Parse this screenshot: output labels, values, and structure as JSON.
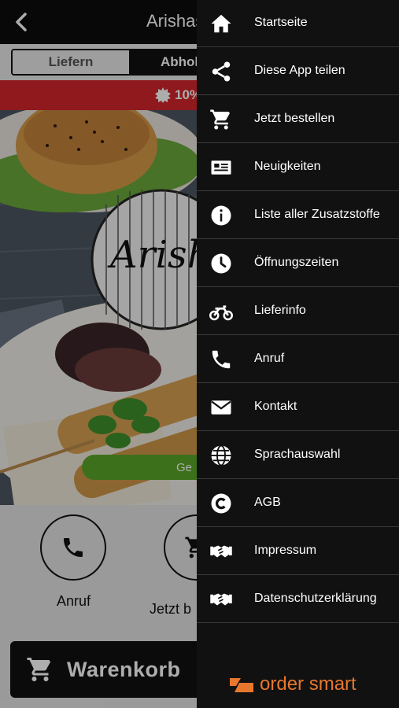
{
  "header": {
    "title": "Arishas",
    "back_icon": "chevron-left-icon"
  },
  "segment": {
    "deliver_label": "Liefern",
    "pickup_label": "Abholen",
    "selected": "Abholen"
  },
  "promo": {
    "text": "10%"
  },
  "hero": {
    "logo_text": "Arish",
    "order_button_label": "Ge"
  },
  "actions": [
    {
      "label": "Anruf",
      "icon": "phone-icon"
    },
    {
      "label": "Jetzt b",
      "icon": "cart-icon"
    }
  ],
  "cart": {
    "label": "Warenkorb",
    "icon": "cart-icon"
  },
  "menu": {
    "items": [
      {
        "label": "Startseite",
        "icon": "home-icon"
      },
      {
        "label": "Diese App teilen",
        "icon": "share-icon"
      },
      {
        "label": "Jetzt bestellen",
        "icon": "cart-icon"
      },
      {
        "label": "Neuigkeiten",
        "icon": "news-icon"
      },
      {
        "label": "Liste aller Zusatzstoffe",
        "icon": "info-icon"
      },
      {
        "label": "Öffnungszeiten",
        "icon": "clock-icon"
      },
      {
        "label": "Lieferinfo",
        "icon": "motorbike-icon"
      },
      {
        "label": "Anruf",
        "icon": "phone-icon"
      },
      {
        "label": "Kontakt",
        "icon": "envelope-icon"
      },
      {
        "label": "Sprachauswahl",
        "icon": "globe-icon"
      },
      {
        "label": "AGB",
        "icon": "copyright-icon"
      },
      {
        "label": "Impressum",
        "icon": "handshake-icon"
      },
      {
        "label": "Datenschutzerklärung",
        "icon": "handshake-icon"
      }
    ]
  },
  "brand": {
    "text": "order smart"
  },
  "colors": {
    "accent_red": "#d3252a",
    "accent_green": "#5aa629",
    "brand_orange": "#e8772e",
    "drawer_bg": "#111111"
  }
}
